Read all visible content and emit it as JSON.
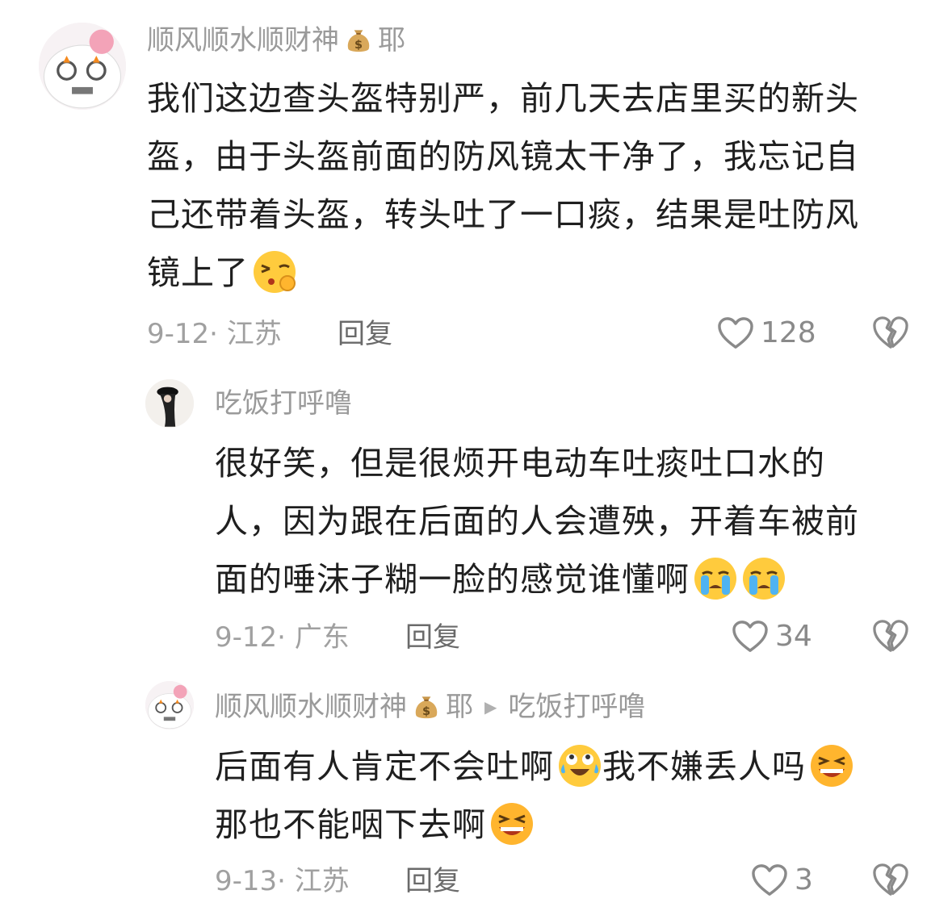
{
  "comments": [
    {
      "username": "顺风顺水顺财神",
      "username_suffix": "耶",
      "lines": [
        "我们这边查头盔特别严，前几天去店里买的新头",
        "盔，由于头盔前面的防风镜太干净了，我忘记自",
        "己还带着头盔，转头吐了一口痰，结果是吐防风",
        "镜上了"
      ],
      "date": "9-12",
      "location": "江苏",
      "reply_label": "回复",
      "likes": "128"
    },
    {
      "username": "吃饭打呼噜",
      "lines": [
        "很好笑，但是很烦开电动车吐痰吐口水的",
        "人，因为跟在后面的人会遭殃，开着车被前",
        "面的唾沫子糊一脸的感觉谁懂啊"
      ],
      "date": "9-12",
      "location": "广东",
      "reply_label": "回复",
      "likes": "34"
    },
    {
      "username": "顺风顺水顺财神",
      "username_suffix": "耶",
      "reply_to": "吃饭打呼噜",
      "lines": [
        "后面有人肯定不会吐啊",
        "我不嫌丢人吗",
        "那也不能咽下去啊"
      ],
      "date": "9-13",
      "location": "江苏",
      "reply_label": "回复",
      "likes": "3"
    }
  ],
  "icons": {
    "like": "heart-outline-icon",
    "dislike": "broken-heart-icon",
    "money_bag": "money-bag-emoji",
    "reply_arrow": "play-triangle-icon"
  },
  "colors": {
    "text": "#1f1f1f",
    "meta": "#a0a0a0",
    "username": "#9a9a9a"
  }
}
